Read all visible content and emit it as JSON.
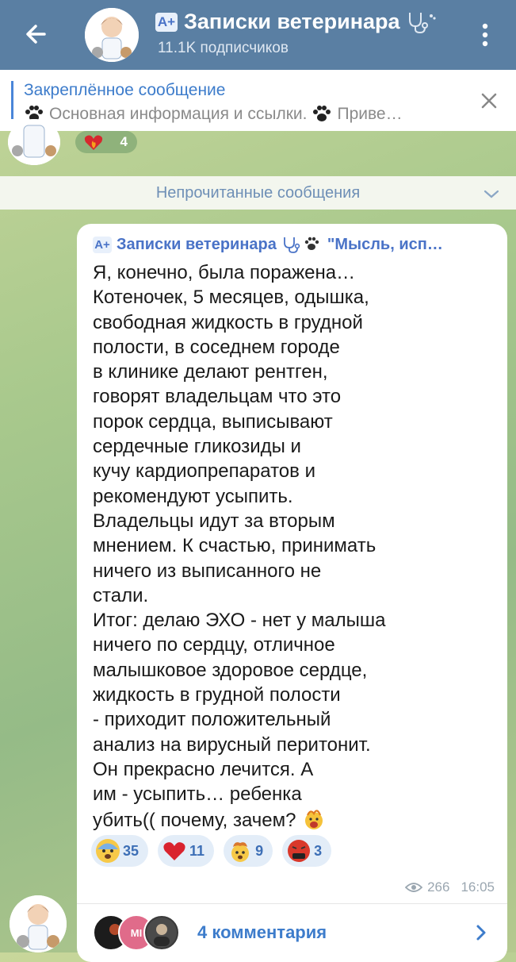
{
  "header": {
    "back_icon": "arrow-left-icon",
    "channel_badge": "A+",
    "channel_name": "Записки ветеринара",
    "subscribers": "11.1K подписчиков",
    "menu_icon": "kebab-icon"
  },
  "pinned": {
    "title": "Закреплённое сообщение",
    "text": "Основная информация и ссылки.",
    "text_more": "Приве…"
  },
  "prev_message": {
    "reaction_emoji": "heart-on-fire",
    "reaction_count": "4"
  },
  "unread": {
    "label": "Непрочитанные сообщения"
  },
  "message": {
    "forward_badge": "A+",
    "forward_from": "Записки ветеринара",
    "forward_quote": "\"Мысль, исп…",
    "text": "Я, конечно, была поражена…\nКотеночек, 5 месяцев, одышка,\nсвободная жидкость в грудной\nполости, в соседнем городе\nв клинике делают рентген,\nговорят владельцам что это\nпорок сердца, выписывают\nсердечные гликозиды и\nкучу кардиопрепаратов и\nрекомендуют усыпить.\nВладельцы идут за вторым\nмнением. К счастью, принимать\nничего из выписанного не\nстали.\nИтог: делаю ЭХО - нет у малыша\nничего по сердцу, отличное\nмалышковое здоровое сердце,\nжидкость в грудной полости\n- приходит положительный\nанализ на вирусный перитонит.\nОн прекрасно лечится. А\nим - усыпить… ребенка\nубить(( почему, зачем?",
    "reactions": [
      {
        "emoji": "😨",
        "name": "fearful-face",
        "count": "35"
      },
      {
        "emoji": "❤",
        "name": "red-heart",
        "count": "11"
      },
      {
        "emoji": "🤯",
        "name": "exploding-head",
        "count": "9"
      },
      {
        "emoji": "🤬",
        "name": "cursing-face",
        "count": "3"
      }
    ],
    "views": "266",
    "time": "16:05",
    "comments_label": "4 комментария",
    "commenter_initials": "MI"
  },
  "colors": {
    "header_bg": "#5a7fa3",
    "accent": "#3d7ccb",
    "reaction_bg": "#e3edf8"
  }
}
